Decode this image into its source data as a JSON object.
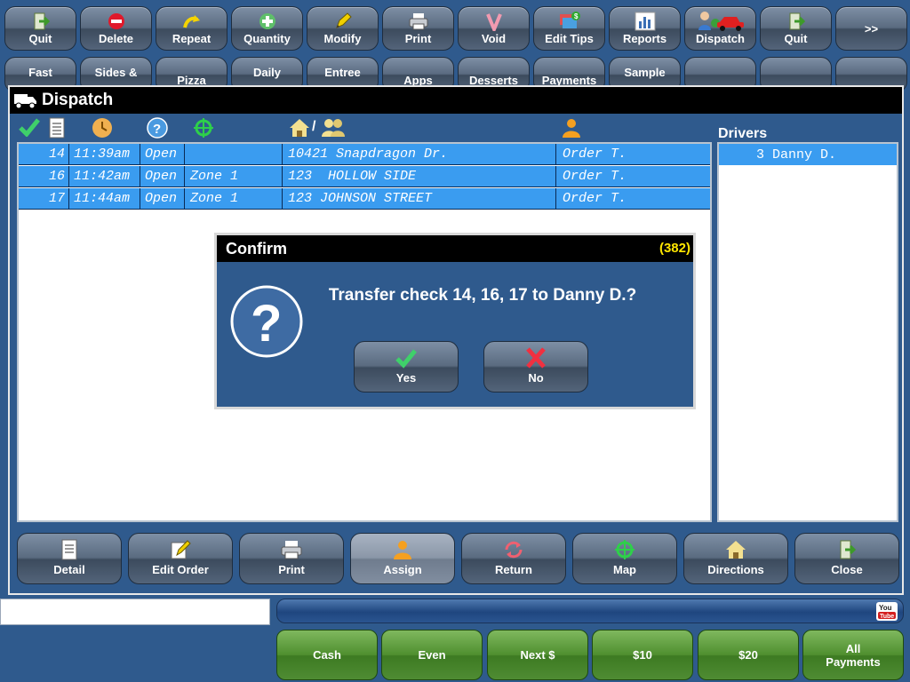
{
  "toolbar": {
    "buttons": [
      {
        "label": "Quit",
        "icon": "exit-door-icon"
      },
      {
        "label": "Delete",
        "icon": "minus-circle-icon"
      },
      {
        "label": "Repeat",
        "icon": "repeat-arrow-icon"
      },
      {
        "label": "Quantity",
        "icon": "plus-circle-icon"
      },
      {
        "label": "Modify",
        "icon": "pencil-icon"
      },
      {
        "label": "Print",
        "icon": "printer-icon"
      },
      {
        "label": "Void",
        "icon": "void-v-icon"
      },
      {
        "label": "Edit Tips",
        "icon": "cash-card-icon"
      },
      {
        "label": "Reports",
        "icon": "bar-chart-icon"
      },
      {
        "label": "Dispatch",
        "icon": "dispatch-car-icon"
      },
      {
        "label": "Quit",
        "icon": "exit-door-icon"
      },
      {
        "label": ">>",
        "icon": ""
      }
    ]
  },
  "category_tabs": [
    "Fast",
    "Sides &",
    "Pizza",
    "Daily",
    "Entree",
    "Apps",
    "Desserts",
    "Payments",
    "Sample",
    "",
    "",
    ""
  ],
  "dispatch": {
    "title": "Dispatch",
    "column_icons": [
      "check-icon",
      "document-icon",
      "clock-icon",
      "help-icon",
      "crosshair-icon",
      "home-customer-icon",
      "driver-icon"
    ],
    "address_header_slash": "/",
    "orders": [
      {
        "check": "14",
        "time": "11:39am",
        "status": "Open",
        "zone": "",
        "address": "10421 Snapdragon Dr.",
        "type": "Order T."
      },
      {
        "check": "16",
        "time": "11:42am",
        "status": "Open",
        "zone": "Zone 1",
        "address": "123  HOLLOW SIDE",
        "type": "Order T."
      },
      {
        "check": "17",
        "time": "11:44am",
        "status": "Open",
        "zone": "Zone 1",
        "address": "123 JOHNSON STREET",
        "type": "Order T."
      }
    ],
    "drivers_label": "Drivers",
    "drivers": [
      "3 Danny D."
    ],
    "actions": [
      {
        "label": "Detail",
        "icon": "document-icon"
      },
      {
        "label": "Edit Order",
        "icon": "edit-icon"
      },
      {
        "label": "Print",
        "icon": "printer-icon"
      },
      {
        "label": "Assign",
        "icon": "driver-icon"
      },
      {
        "label": "Return",
        "icon": "return-arrows-icon"
      },
      {
        "label": "Map",
        "icon": "crosshair-icon"
      },
      {
        "label": "Directions",
        "icon": "home-icon"
      },
      {
        "label": "Close",
        "icon": "exit-door-icon"
      }
    ]
  },
  "confirm": {
    "title": "Confirm",
    "code": "(382)",
    "message": "Transfer check 14, 16, 17 to Danny D.?",
    "yes_label": "Yes",
    "no_label": "No"
  },
  "payments": [
    "Cash",
    "Even",
    "Next $",
    "$10",
    "$20",
    "All Payments"
  ],
  "colors": {
    "background": "#2f5a8d",
    "row_highlight": "#3a9cf0",
    "payment_green": "#4f8f2f",
    "title_bar": "#000000",
    "code_yellow": "#ffe600"
  }
}
